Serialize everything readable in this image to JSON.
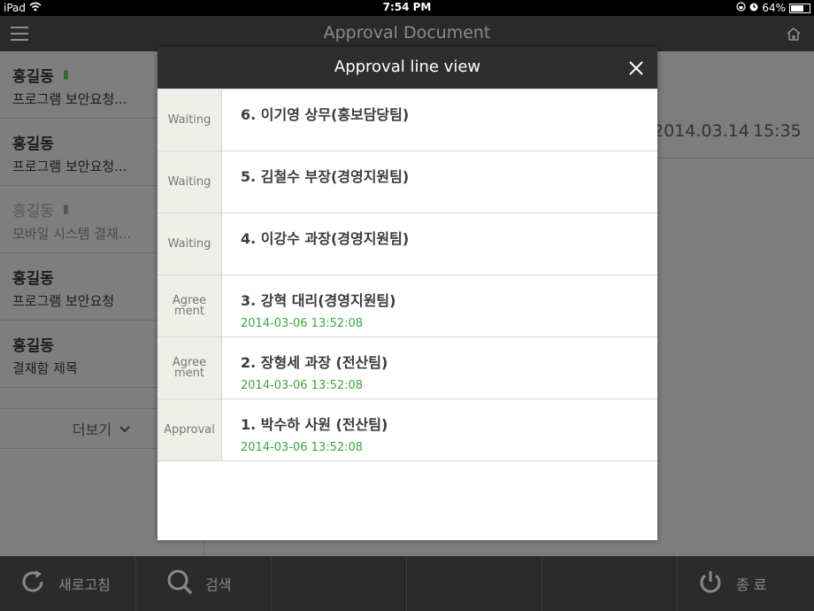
{
  "status_bar": {
    "device": "iPad",
    "time": "7:54 PM",
    "battery": "64%",
    "battery_level": 0.64
  },
  "nav": {
    "title": "Approval Document"
  },
  "sidebar": {
    "items": [
      {
        "name": "홍길동",
        "subject": "프로그램 보안요청...",
        "attachment": true,
        "read": false,
        "count": ""
      },
      {
        "name": "홍길동",
        "subject": "프로그램 보안요청...",
        "attachment": false,
        "read": false,
        "count": ""
      },
      {
        "name": "홍길동",
        "subject": "모바일 시스템 결재...",
        "attachment": true,
        "read": true,
        "count": ""
      },
      {
        "name": "홍길동",
        "subject": "프로그램 보안요청",
        "attachment": false,
        "read": false,
        "count": "("
      },
      {
        "name": "홍길동",
        "subject": "결재함 제목",
        "attachment": false,
        "read": false,
        "count": "("
      }
    ],
    "more_label": "더보기"
  },
  "detail": {
    "date": "2014.03.14",
    "time": "15:35"
  },
  "toolbar": {
    "refresh_label": "새로고침",
    "search_label": "검색",
    "exit_label": "종 료"
  },
  "modal": {
    "title": "Approval line view",
    "rows": [
      {
        "status": "Waiting",
        "name": "6. 이기영 상무(홍보담당팀)",
        "date": ""
      },
      {
        "status": "Waiting",
        "name": "5. 김철수 부장(경영지원팀)",
        "date": ""
      },
      {
        "status": "Waiting",
        "name": "4. 이강수 과장(경영지원팀)",
        "date": ""
      },
      {
        "status": "Agree ment",
        "name": "3. 강혁 대리(경영지원팀)",
        "date": "2014-03-06 13:52:08"
      },
      {
        "status": "Agree ment",
        "name": "2. 장형세 과장 (전산팀)",
        "date": "2014-03-06 13:52:08"
      },
      {
        "status": "Approval",
        "name": "1. 박수하 사원 (전산팀)",
        "date": "2014-03-06 13:52:08"
      }
    ]
  },
  "colors": {
    "approved_date": "#3aa83a",
    "header_bg": "#2e2e2e",
    "status_bg": "#efefe9"
  }
}
